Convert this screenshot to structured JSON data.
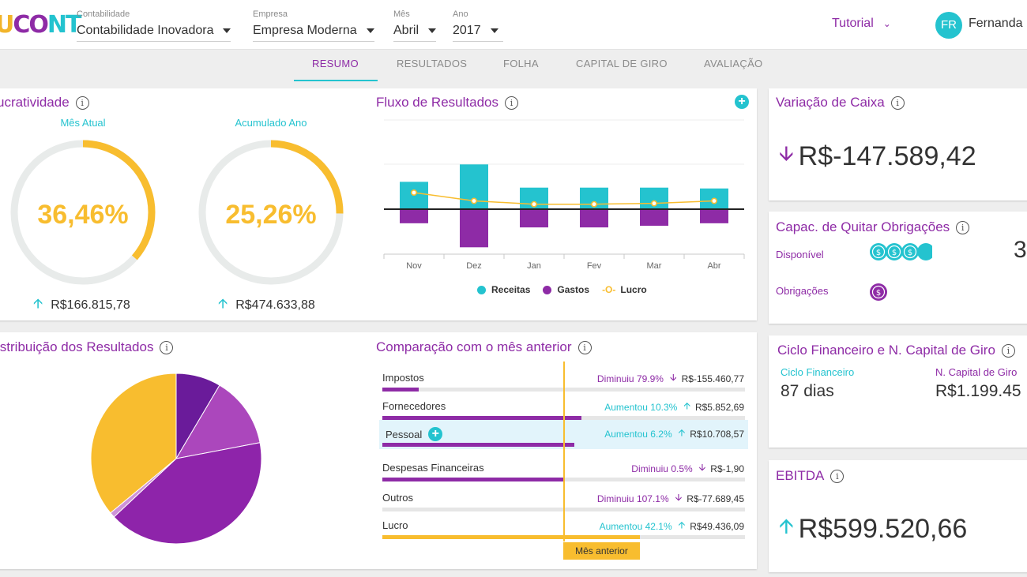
{
  "header": {
    "logo": {
      "c1": "U",
      "c2": "CO",
      "c3": "NT"
    },
    "selectors": [
      {
        "label": "Contabilidade",
        "value": "Contabilidade Inovadora"
      },
      {
        "label": "Empresa",
        "value": "Empresa Moderna"
      },
      {
        "label": "Mês",
        "value": "Abril"
      },
      {
        "label": "Ano",
        "value": "2017"
      }
    ],
    "tutorial": "Tutorial",
    "avatar_initials": "FR",
    "user_name": "Fernanda"
  },
  "tabs": [
    "RESUMO",
    "RESULTADOS",
    "FOLHA",
    "CAPITAL DE GIRO",
    "AVALIAÇÃO"
  ],
  "active_tab": "RESUMO",
  "lucratividade": {
    "title": "ucratividade",
    "month_label": "Mês Atual",
    "month_value": "36,46%",
    "month_pct": 36.46,
    "month_amount": "R$166.815,78",
    "year_label": "Acumulado Ano",
    "year_value": "25,26%",
    "year_pct": 25.26,
    "year_amount": "R$474.633,88"
  },
  "fluxo": {
    "title": "Fluxo de Resultados",
    "legend": [
      "Receitas",
      "Gastos",
      "Lucro"
    ]
  },
  "chart_data": {
    "type": "bar",
    "title": "Fluxo de Resultados",
    "categories": [
      "Nov",
      "Dez",
      "Jan",
      "Fev",
      "Mar",
      "Abr"
    ],
    "series": [
      {
        "name": "Receitas",
        "values": [
          33,
          54,
          26,
          26,
          26,
          25
        ],
        "color": "#24c3cf"
      },
      {
        "name": "Gastos",
        "values": [
          -17,
          -46,
          -22,
          -22,
          -20,
          -17
        ],
        "color": "#8e2ba6"
      },
      {
        "name": "Lucro",
        "values": [
          20,
          10,
          6,
          6,
          7,
          10
        ],
        "color": "#f8bd2f"
      }
    ]
  },
  "variacao": {
    "title": "Variação de Caixa",
    "value": "R$-147.589,42"
  },
  "capac": {
    "title": "Capac. de Quitar Obrigações",
    "disponivel": "Disponível",
    "obrigacoes": "Obrigações",
    "ratio_partial": "3"
  },
  "ciclo": {
    "title": "Ciclo Financeiro e N. Capital de Giro",
    "ciclo_label": "Ciclo Financeiro",
    "ciclo_value": "87 dias",
    "ncg_label": "N. Capital de Giro",
    "ncg_value": "R$1.199.45"
  },
  "ebitda": {
    "title": "EBITDA",
    "value": "R$599.520,66"
  },
  "distribuicao": {
    "title": "istribuição dos Resultados",
    "slices": [
      {
        "value": 8.5,
        "color": "#6a1b9a"
      },
      {
        "value": 13.5,
        "color": "#ab47bc"
      },
      {
        "value": 41,
        "color": "#8e24aa"
      },
      {
        "value": 1,
        "color": "#ce93d8"
      },
      {
        "value": 36,
        "color": "#f8bd2f"
      }
    ]
  },
  "comparacao": {
    "title": "Comparação com o mês anterior",
    "prev_label": "Mês anterior",
    "rows": [
      {
        "name": "Impostos",
        "pct": "Diminuiu 79.9%",
        "amount": "R$-155.460,77",
        "dir": "down",
        "fill": 0.1,
        "color": "#8e2ba6"
      },
      {
        "name": "Fornecedores",
        "pct": "Aumentou 10.3%",
        "amount": "R$5.852,69",
        "dir": "up",
        "fill": 0.55,
        "color": "#8e2ba6"
      },
      {
        "name": "Pessoal",
        "pct": "Aumentou 6.2%",
        "amount": "R$10.708,57",
        "dir": "up",
        "fill": 0.53,
        "color": "#8e2ba6"
      },
      {
        "name": "Despesas Financeiras",
        "pct": "Diminuiu 0.5%",
        "amount": "R$-1,90",
        "dir": "down",
        "fill": 0.5,
        "color": "#8e2ba6"
      },
      {
        "name": "Outros",
        "pct": "Diminuiu 107.1%",
        "amount": "R$-77.689,45",
        "dir": "down",
        "fill": 0.0,
        "color": "#8e2ba6"
      },
      {
        "name": "Lucro",
        "pct": "Aumentou 42.1%",
        "amount": "R$49.436,09",
        "dir": "up",
        "fill": 0.71,
        "color": "#f8bd2f"
      }
    ]
  }
}
